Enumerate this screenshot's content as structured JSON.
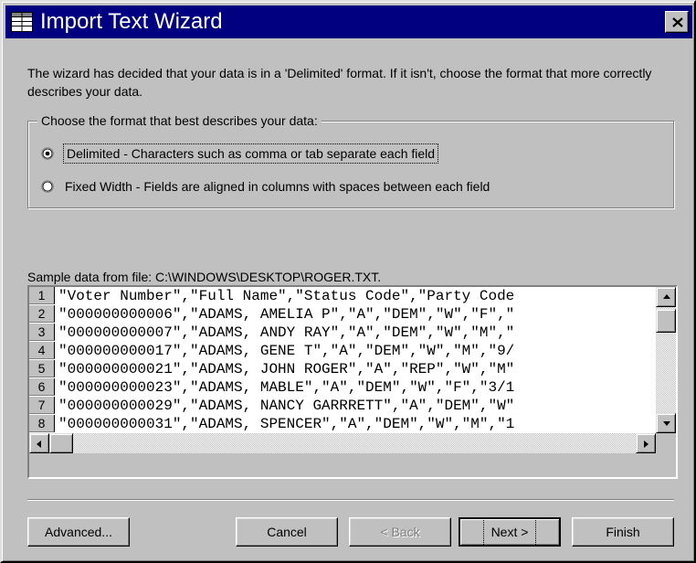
{
  "window": {
    "title": "Import Text Wizard",
    "title_icon": "table-grid-icon",
    "close_icon": "close-icon"
  },
  "intro": {
    "text": "The wizard has decided that your data is in a 'Delimited' format.  If it isn't, choose the format that more correctly describes your data."
  },
  "format_group": {
    "legend": "Choose the format that best describes your data:",
    "options": [
      {
        "label": "Delimited - Characters such as comma or tab separate each field",
        "selected": true
      },
      {
        "label": "Fixed Width - Fields are aligned in columns with spaces between each field",
        "selected": false
      }
    ]
  },
  "sample": {
    "label": "Sample data from file: C:\\WINDOWS\\DESKTOP\\ROGER.TXT.",
    "rows": [
      {
        "num": "1",
        "text": "\"Voter Number\",\"Full Name\",\"Status Code\",\"Party Code"
      },
      {
        "num": "2",
        "text": "\"000000000006\",\"ADAMS, AMELIA P\",\"A\",\"DEM\",\"W\",\"F\",\""
      },
      {
        "num": "3",
        "text": "\"000000000007\",\"ADAMS, ANDY RAY\",\"A\",\"DEM\",\"W\",\"M\",\""
      },
      {
        "num": "4",
        "text": "\"000000000017\",\"ADAMS, GENE T\",\"A\",\"DEM\",\"W\",\"M\",\"9/"
      },
      {
        "num": "5",
        "text": "\"000000000021\",\"ADAMS, JOHN ROGER\",\"A\",\"REP\",\"W\",\"M\""
      },
      {
        "num": "6",
        "text": "\"000000000023\",\"ADAMS, MABLE\",\"A\",\"DEM\",\"W\",\"F\",\"3/1"
      },
      {
        "num": "7",
        "text": "\"000000000029\",\"ADAMS, NANCY GARRRETT\",\"A\",\"DEM\",\"W\""
      },
      {
        "num": "8",
        "text": "\"000000000031\",\"ADAMS, SPENCER\",\"A\",\"DEM\",\"W\",\"M\",\"1"
      }
    ]
  },
  "buttons": {
    "advanced": "Advanced...",
    "cancel": "Cancel",
    "back": "< Back",
    "next": "Next >",
    "finish": "Finish"
  },
  "colors": {
    "titlebar": "#000080",
    "face": "#c0c0c0"
  }
}
